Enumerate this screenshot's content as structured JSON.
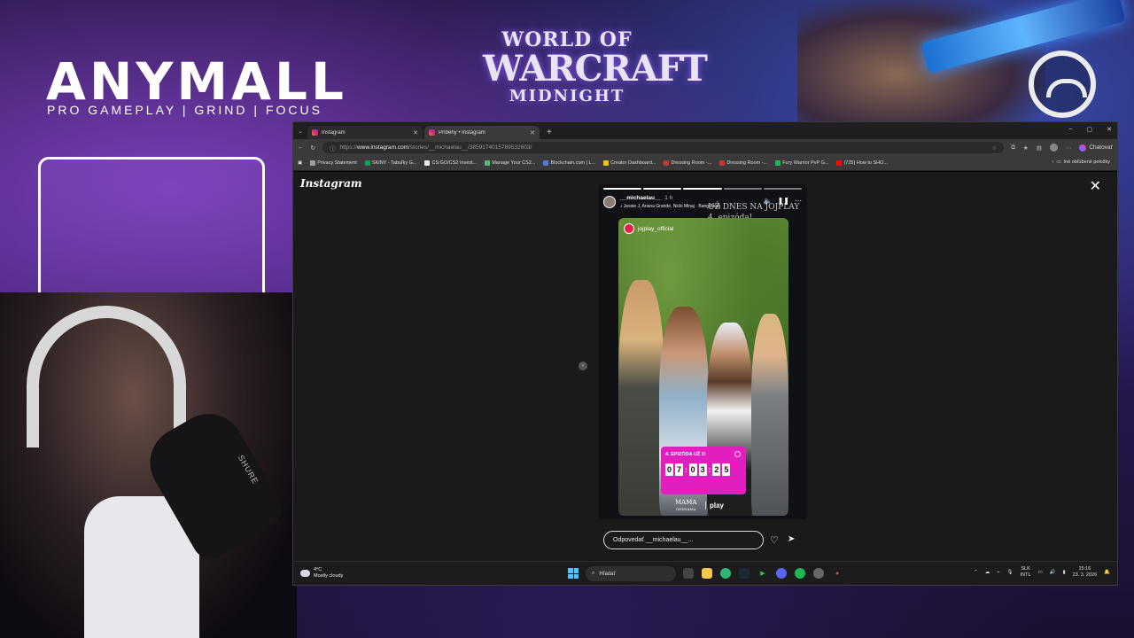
{
  "overlay": {
    "brand_title": "ANYMALL",
    "brand_subtitle": "PRO GAMEPLAY | GRIND | FOCUS",
    "game_logo": {
      "line1": "WORLD OF",
      "line2": "WARCRAFT",
      "line3": "MIDNIGHT"
    },
    "mic_label": "SHURE"
  },
  "browser": {
    "tabs": [
      {
        "title": "Instagram",
        "active": false
      },
      {
        "title": "Príbehy • Instagram",
        "active": true
      }
    ],
    "new_tab_label": "+",
    "window_controls": [
      "–",
      "▢",
      "✕"
    ],
    "url": {
      "scheme": "https://",
      "host": "www.instagram.com",
      "path": "/stories/__michaelau__/3859174015789532603/"
    },
    "chat_button_label": "Chatovať",
    "bookmarks": [
      {
        "label": "Privacy Statement",
        "color": "#9aa0a6"
      },
      {
        "label": "SKINY - Tabuľky G...",
        "color": "#0f9d58"
      },
      {
        "label": "CS:GO/CS2 Invest...",
        "color": "#e8e8e8"
      },
      {
        "label": "Manage Your CS2...",
        "color": "#5bb974"
      },
      {
        "label": "Blockchain.com | L...",
        "color": "#4a7bd8"
      },
      {
        "label": "Creator Dashboard...",
        "color": "#f2c200"
      },
      {
        "label": "Dressing Room -...",
        "color": "#c0392b"
      },
      {
        "label": "Dressing Room -...",
        "color": "#c0392b"
      },
      {
        "label": "Fury Warrior PvP G...",
        "color": "#1db954"
      },
      {
        "label": "(725) How to SHO...",
        "color": "#ff0000"
      }
    ],
    "other_bookmarks_label": "Iné obľúbené položky"
  },
  "instagram": {
    "logo": "Instagram",
    "close_label": "✕",
    "story": {
      "username": "__michaelau__",
      "time": "1 h",
      "music": "Jessie J, Ariana Grande, Nicki Minaj · Bang Bang",
      "overlay_text_line1": "UŽ DNES NA JOJPLAY",
      "overlay_text_line2": "4. epizóda!",
      "tag_account": "jojplay_official",
      "countdown": {
        "title": "4. EPIZÓDA UŽ O",
        "digits": [
          "0",
          "7",
          "0",
          "3",
          "2",
          "5"
        ]
      },
      "brand_left": "MAMA",
      "brand_left_small": "ODZNAMA",
      "brand_right": "play"
    },
    "reply_placeholder": "Odpovedať __michaelau__..."
  },
  "taskbar": {
    "weather_temp": "4°C",
    "weather_desc": "Mostly cloudy",
    "search_placeholder": "Hľadať",
    "lang_line1": "SLK",
    "lang_line2": "INTL",
    "time": "15:16",
    "date": "23. 3. 2026"
  }
}
